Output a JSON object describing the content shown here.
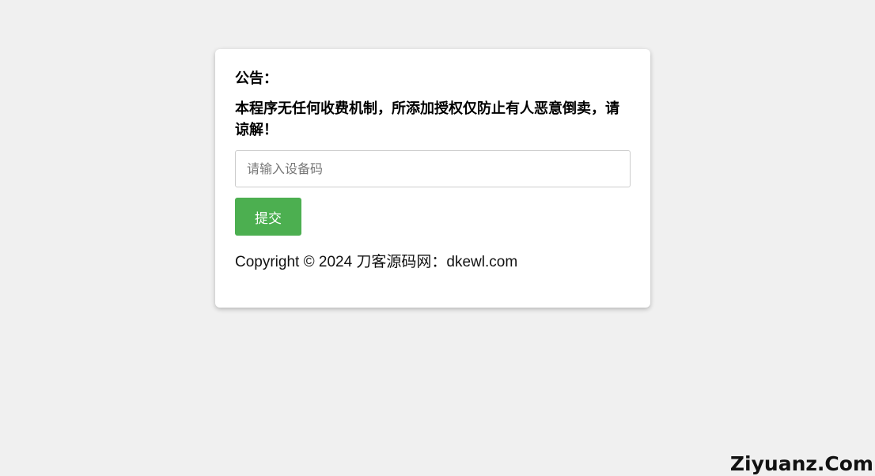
{
  "notice": {
    "title": "公告：",
    "text": "本程序无任何收费机制，所添加授权仅防止有人恶意倒卖，请谅解！"
  },
  "form": {
    "device_placeholder": "请输入设备码",
    "device_value": "",
    "submit_label": "提交"
  },
  "footer": {
    "copyright": "Copyright © 2024 刀客源码网：dkewl.com"
  },
  "watermark": {
    "text": "Ziyuanz.Com"
  },
  "colors": {
    "background": "#f0f0f0",
    "card": "#ffffff",
    "button": "#4caf50"
  }
}
